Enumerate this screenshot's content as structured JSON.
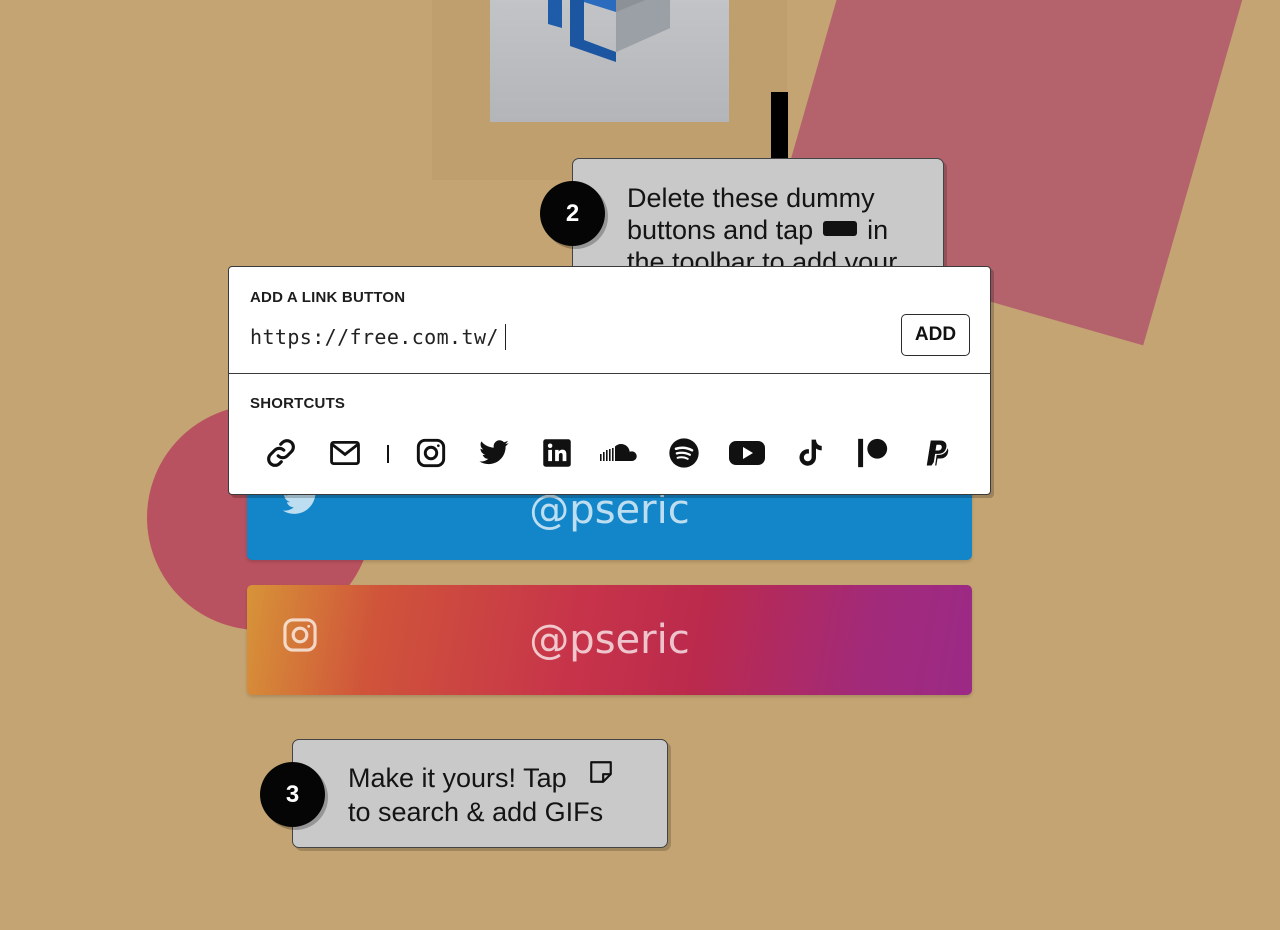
{
  "notes": {
    "step2": {
      "number": "2",
      "line1": "Delete these dummy",
      "line2_before": "buttons and tap",
      "line2_after": "in",
      "line3": "the toolbar to add your"
    },
    "step3": {
      "number": "3",
      "line1": "Make it yours! Tap",
      "line2": "to search & add GIFs"
    }
  },
  "link_buttons": [
    {
      "label": "@pseric",
      "icon": "twitter-icon",
      "color": "#1385c9"
    },
    {
      "label": "@pseric",
      "icon": "instagram-icon",
      "color": "#c7344a"
    }
  ],
  "popup": {
    "title": "ADD A LINK BUTTON",
    "url_value": "https://free.com.tw/",
    "add_label": "ADD",
    "shortcuts_title": "SHORTCUTS",
    "shortcuts": [
      "link-icon",
      "mail-icon",
      "instagram-icon",
      "twitter-icon",
      "linkedin-icon",
      "soundcloud-icon",
      "spotify-icon",
      "youtube-icon",
      "tiktok-icon",
      "patreon-icon",
      "paypal-icon"
    ]
  },
  "colors": {
    "background": "#c4a472",
    "pink_shape": "#b4636d",
    "circle": "#b95260",
    "note": "#c9c9c9"
  }
}
